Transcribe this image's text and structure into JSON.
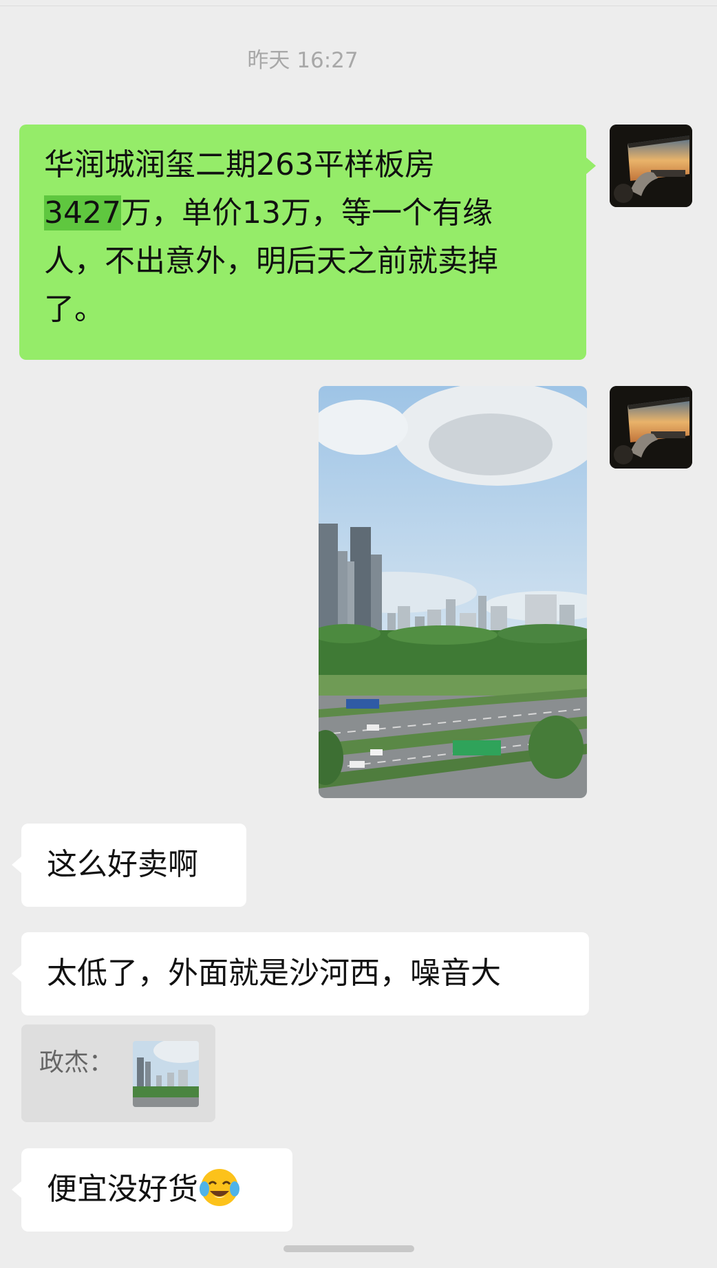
{
  "chat": {
    "timestamp": "昨天 16:27",
    "messages": [
      {
        "side": "sent",
        "type": "text",
        "line1": "华润城润玺二期263平样板房",
        "highlight": "3427",
        "line2_rest": "万，单价13万，等一个有缘",
        "line3": "人，不出意外，明后天之前就卖掉",
        "line4": "了。"
      },
      {
        "side": "sent",
        "type": "image",
        "image_icon": "city-skyline-photo"
      },
      {
        "side": "received",
        "type": "text",
        "text": "这么好卖啊"
      },
      {
        "side": "received",
        "type": "text",
        "text": "太低了，外面就是沙河西，噪音大"
      },
      {
        "side": "received",
        "type": "quote",
        "sender": "政杰：",
        "thumb_icon": "city-skyline-thumbnail"
      },
      {
        "side": "received",
        "type": "text",
        "text": "便宜没好货",
        "emoji": "tears-of-joy-emoji"
      }
    ]
  },
  "colors": {
    "background": "#ededed",
    "sent_bubble": "#95ec69",
    "received_bubble": "#ffffff",
    "highlight": "#5fc73f"
  }
}
